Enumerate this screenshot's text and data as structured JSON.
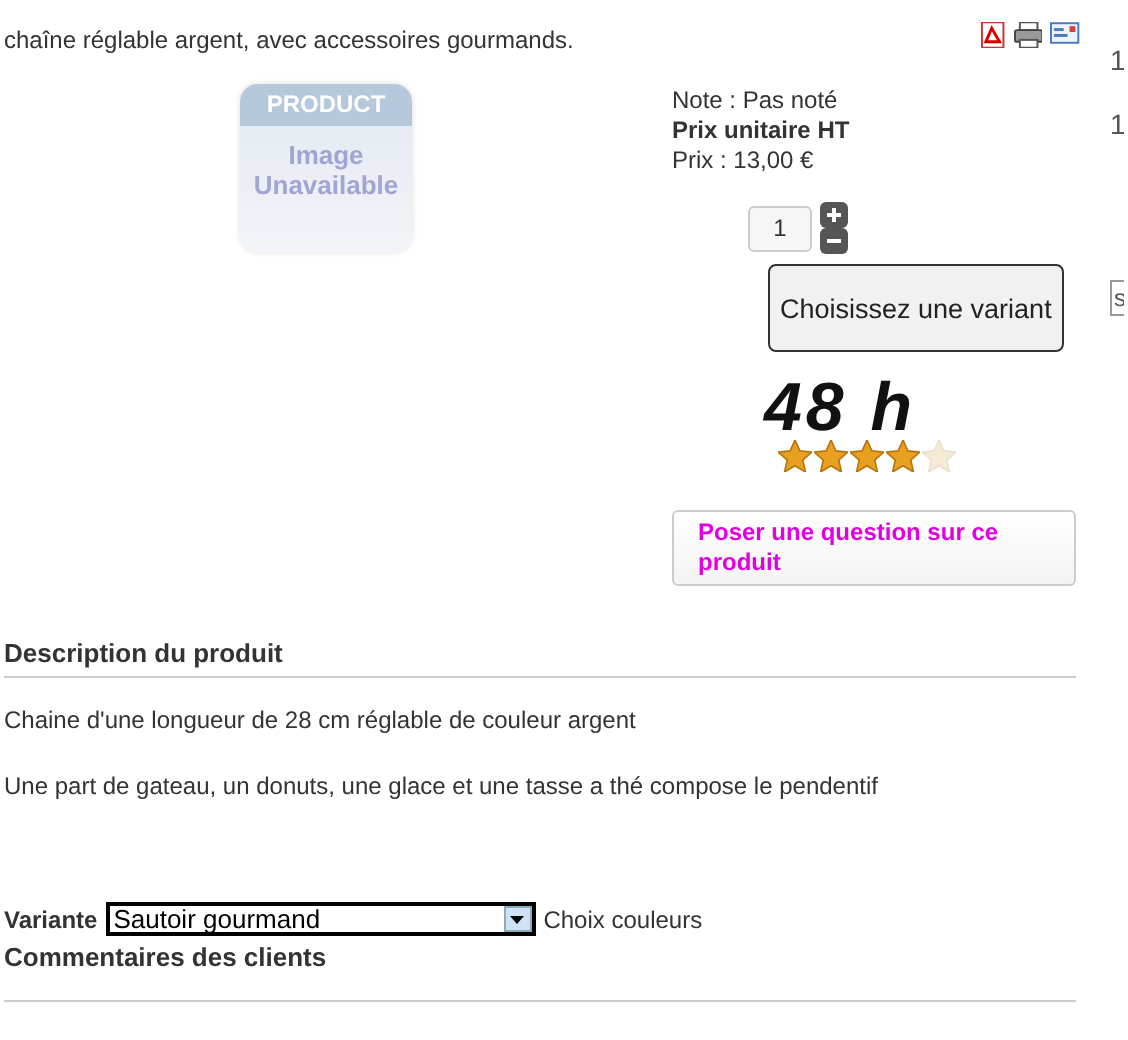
{
  "product": {
    "summary": "chaîne réglable argent, avec accessoires gourmands.",
    "image": {
      "top_text": "PRODUCT",
      "main_text": "Image Unavailable"
    },
    "rating_note": "Note : Pas noté",
    "price_label": "Prix unitaire HT",
    "price": "Prix : 13,00 €",
    "quantity": "1",
    "variant_button": "Choisissez une variant",
    "delivery": "48 h",
    "stars": 4,
    "ask_button": "Poser une question sur ce produit"
  },
  "description": {
    "heading": "Description du produit",
    "paragraphs": [
      "Chaine d'une longueur de 28 cm réglable de couleur argent",
      "Une part de gateau, un donuts, une glace et une tasse a thé compose le pendentif"
    ]
  },
  "variant": {
    "label": "Variante",
    "value": "Sautoir gourmand",
    "note": "Choix couleurs"
  },
  "comments_heading": "Commentaires des clients",
  "sidebar": [
    {
      "kind": "text",
      "text": "1"
    },
    {
      "kind": "text",
      "text": "1"
    },
    {
      "kind": "field",
      "text": "s"
    }
  ]
}
